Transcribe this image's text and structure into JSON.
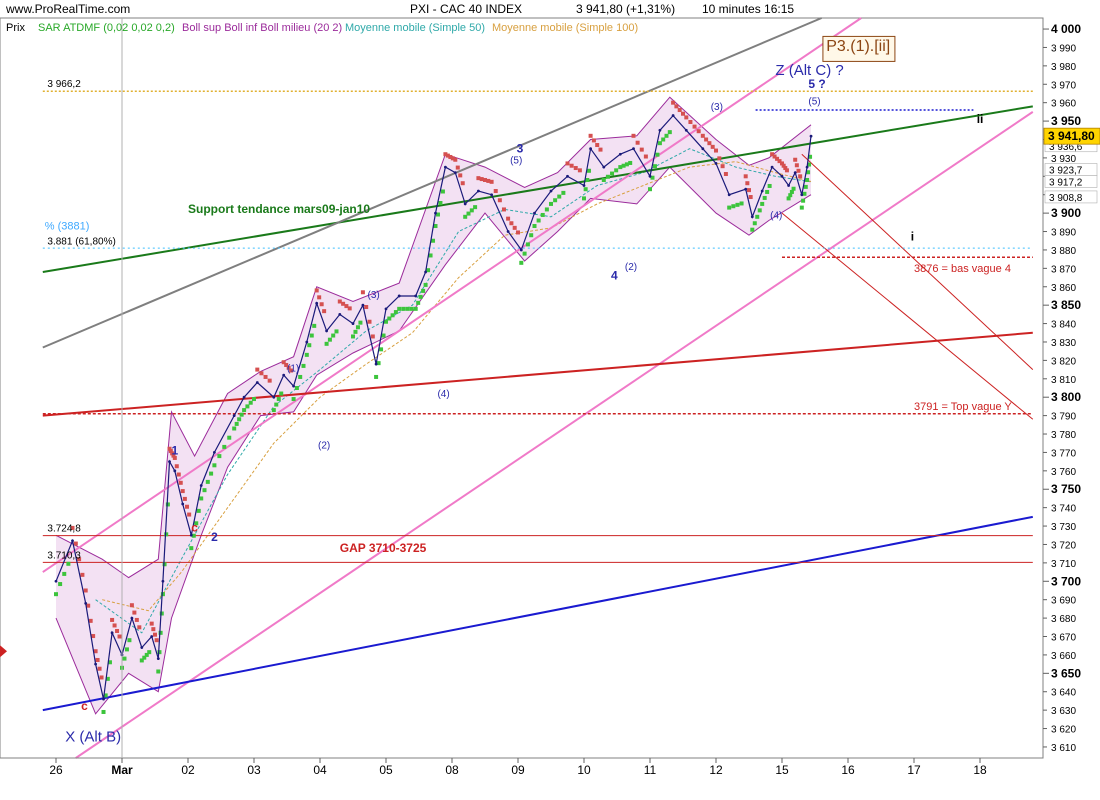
{
  "header": {
    "site": "www.ProRealTime.com",
    "instrument": "PXI - CAC 40 INDEX",
    "price_change": "3 941,80  (+1,31%)",
    "timeframe": "10 minutes  16:15"
  },
  "legend": {
    "prix": "Prix",
    "sar": "SAR ATDMF (0,02 0,02 0,2)",
    "boll": "Boll sup Boll inf Boll milieu (20 2)",
    "ma50": "Moyenne mobile (Simple 50)",
    "ma100": "Moyenne mobile (Simple 100)"
  },
  "colors": {
    "price": "#1a1a7a",
    "boll": "#9b2b9b",
    "boll_fill": "#f3e1f3",
    "sar_up": "#3cc43c",
    "sar_down": "#d55050",
    "ma50": "#2fa9a9",
    "ma100": "#d8a040",
    "channel": "#f07ac8",
    "support": "#1a7a1a",
    "gray_line": "#7f7f7f",
    "blue_line": "#1a1ad0",
    "red_line": "#cc2222",
    "fib": "#3fbfff",
    "orange_dotted": "#e0b030",
    "last_box": "#ffd400"
  },
  "chart_data": {
    "type": "line",
    "title": "PXI - CAC 40 INDEX",
    "timeframe": "10 minutes",
    "last_price": 3941.8,
    "change_pct": 1.31,
    "x_ticks": [
      "26",
      "Mar",
      "02",
      "03",
      "04",
      "05",
      "08",
      "09",
      "10",
      "11",
      "12",
      "15",
      "16",
      "17",
      "18"
    ],
    "ylim": [
      3604,
      4006
    ],
    "y_ticks": [
      3610,
      3620,
      3630,
      3640,
      3650,
      3660,
      3670,
      3680,
      3690,
      3700,
      3710,
      3720,
      3730,
      3740,
      3750,
      3760,
      3770,
      3780,
      3790,
      3800,
      3810,
      3820,
      3830,
      3840,
      3850,
      3860,
      3870,
      3880,
      3890,
      3900,
      3910,
      3920,
      3930,
      3940,
      3950,
      3960,
      3970,
      3980,
      3990,
      4000
    ],
    "y_tick_labels": [
      "3 610",
      "3 620",
      "3 630",
      "3 640",
      "3 650",
      "3 660",
      "3 670",
      "3 680",
      "3 690",
      "3 700",
      "3 710",
      "3 720",
      "3 730",
      "3 740",
      "3 750",
      "3 760",
      "3 770",
      "3 780",
      "3 790",
      "3 800",
      "3 810",
      "3 820",
      "3 830",
      "3 840",
      "3 850",
      "3 860",
      "3 870",
      "3 880",
      "3 890",
      "3 900",
      "3 910",
      "3 920",
      "3 930",
      "3 940",
      "3 950",
      "3 960",
      "3 970",
      "3 980",
      "3 990",
      "4 000"
    ],
    "y_major_labels": [
      "3 650",
      "3 700",
      "3 750",
      "3 800",
      "3 850",
      "3 900",
      "3 950",
      "4 000"
    ],
    "price_series": [
      {
        "x": 0.0,
        "y": 3700
      },
      {
        "x": 0.25,
        "y": 3722
      },
      {
        "x": 0.45,
        "y": 3688
      },
      {
        "x": 0.6,
        "y": 3655
      },
      {
        "x": 0.72,
        "y": 3636
      },
      {
        "x": 0.85,
        "y": 3672
      },
      {
        "x": 1.0,
        "y": 3660
      },
      {
        "x": 1.15,
        "y": 3680
      },
      {
        "x": 1.3,
        "y": 3664
      },
      {
        "x": 1.45,
        "y": 3670
      },
      {
        "x": 1.55,
        "y": 3658
      },
      {
        "x": 1.62,
        "y": 3700
      },
      {
        "x": 1.72,
        "y": 3765
      },
      {
        "x": 1.8,
        "y": 3760
      },
      {
        "x": 1.92,
        "y": 3742
      },
      {
        "x": 2.05,
        "y": 3725
      },
      {
        "x": 2.2,
        "y": 3752
      },
      {
        "x": 2.4,
        "y": 3770
      },
      {
        "x": 2.7,
        "y": 3790
      },
      {
        "x": 2.85,
        "y": 3800
      },
      {
        "x": 3.05,
        "y": 3808
      },
      {
        "x": 3.3,
        "y": 3800
      },
      {
        "x": 3.45,
        "y": 3812
      },
      {
        "x": 3.6,
        "y": 3806
      },
      {
        "x": 3.8,
        "y": 3830
      },
      {
        "x": 3.95,
        "y": 3851
      },
      {
        "x": 4.1,
        "y": 3836
      },
      {
        "x": 4.3,
        "y": 3845
      },
      {
        "x": 4.5,
        "y": 3840
      },
      {
        "x": 4.65,
        "y": 3850
      },
      {
        "x": 4.85,
        "y": 3818
      },
      {
        "x": 5.0,
        "y": 3848
      },
      {
        "x": 5.2,
        "y": 3855
      },
      {
        "x": 5.45,
        "y": 3855
      },
      {
        "x": 5.6,
        "y": 3868
      },
      {
        "x": 5.75,
        "y": 3900
      },
      {
        "x": 5.9,
        "y": 3925
      },
      {
        "x": 6.05,
        "y": 3922
      },
      {
        "x": 6.2,
        "y": 3905
      },
      {
        "x": 6.4,
        "y": 3912
      },
      {
        "x": 6.6,
        "y": 3910
      },
      {
        "x": 6.85,
        "y": 3890
      },
      {
        "x": 7.05,
        "y": 3880
      },
      {
        "x": 7.25,
        "y": 3900
      },
      {
        "x": 7.5,
        "y": 3912
      },
      {
        "x": 7.75,
        "y": 3920
      },
      {
        "x": 8.0,
        "y": 3915
      },
      {
        "x": 8.1,
        "y": 3935
      },
      {
        "x": 8.3,
        "y": 3925
      },
      {
        "x": 8.55,
        "y": 3932
      },
      {
        "x": 8.75,
        "y": 3935
      },
      {
        "x": 9.0,
        "y": 3920
      },
      {
        "x": 9.15,
        "y": 3945
      },
      {
        "x": 9.35,
        "y": 3953
      },
      {
        "x": 9.55,
        "y": 3945
      },
      {
        "x": 9.8,
        "y": 3935
      },
      {
        "x": 10.0,
        "y": 3927
      },
      {
        "x": 10.2,
        "y": 3910
      },
      {
        "x": 10.45,
        "y": 3913
      },
      {
        "x": 10.55,
        "y": 3898
      },
      {
        "x": 10.7,
        "y": 3912
      },
      {
        "x": 10.85,
        "y": 3925
      },
      {
        "x": 11.0,
        "y": 3920
      },
      {
        "x": 11.1,
        "y": 3915
      },
      {
        "x": 11.2,
        "y": 3922
      },
      {
        "x": 11.3,
        "y": 3910
      },
      {
        "x": 11.38,
        "y": 3925
      },
      {
        "x": 11.44,
        "y": 3941.8
      }
    ],
    "boll_upper": [
      {
        "x": 0.0,
        "y": 3725
      },
      {
        "x": 0.7,
        "y": 3712
      },
      {
        "x": 1.1,
        "y": 3702
      },
      {
        "x": 1.55,
        "y": 3712
      },
      {
        "x": 1.75,
        "y": 3792
      },
      {
        "x": 2.1,
        "y": 3768
      },
      {
        "x": 2.6,
        "y": 3802
      },
      {
        "x": 3.1,
        "y": 3814
      },
      {
        "x": 3.6,
        "y": 3822
      },
      {
        "x": 3.95,
        "y": 3860
      },
      {
        "x": 4.5,
        "y": 3852
      },
      {
        "x": 5.2,
        "y": 3862
      },
      {
        "x": 5.9,
        "y": 3932
      },
      {
        "x": 6.5,
        "y": 3925
      },
      {
        "x": 7.1,
        "y": 3914
      },
      {
        "x": 7.6,
        "y": 3922
      },
      {
        "x": 8.1,
        "y": 3940
      },
      {
        "x": 8.8,
        "y": 3942
      },
      {
        "x": 9.3,
        "y": 3963
      },
      {
        "x": 10.0,
        "y": 3940
      },
      {
        "x": 10.5,
        "y": 3926
      },
      {
        "x": 10.8,
        "y": 3930
      },
      {
        "x": 11.44,
        "y": 3948
      }
    ],
    "boll_lower": [
      {
        "x": 0.0,
        "y": 3680
      },
      {
        "x": 0.6,
        "y": 3628
      },
      {
        "x": 1.1,
        "y": 3650
      },
      {
        "x": 1.55,
        "y": 3640
      },
      {
        "x": 1.75,
        "y": 3680
      },
      {
        "x": 2.2,
        "y": 3725
      },
      {
        "x": 2.6,
        "y": 3762
      },
      {
        "x": 3.1,
        "y": 3790
      },
      {
        "x": 3.6,
        "y": 3792
      },
      {
        "x": 3.95,
        "y": 3812
      },
      {
        "x": 4.5,
        "y": 3824
      },
      {
        "x": 5.2,
        "y": 3836
      },
      {
        "x": 5.9,
        "y": 3872
      },
      {
        "x": 6.5,
        "y": 3900
      },
      {
        "x": 7.1,
        "y": 3874
      },
      {
        "x": 7.6,
        "y": 3890
      },
      {
        "x": 8.1,
        "y": 3908
      },
      {
        "x": 8.8,
        "y": 3905
      },
      {
        "x": 9.3,
        "y": 3925
      },
      {
        "x": 10.0,
        "y": 3900
      },
      {
        "x": 10.5,
        "y": 3888
      },
      {
        "x": 10.8,
        "y": 3896
      },
      {
        "x": 11.44,
        "y": 3910
      }
    ],
    "ma50": [
      {
        "x": 0.6,
        "y": 3690
      },
      {
        "x": 1.3,
        "y": 3672
      },
      {
        "x": 1.9,
        "y": 3712
      },
      {
        "x": 2.6,
        "y": 3758
      },
      {
        "x": 3.3,
        "y": 3795
      },
      {
        "x": 4.0,
        "y": 3815
      },
      {
        "x": 4.7,
        "y": 3836
      },
      {
        "x": 5.4,
        "y": 3850
      },
      {
        "x": 6.1,
        "y": 3890
      },
      {
        "x": 6.8,
        "y": 3902
      },
      {
        "x": 7.5,
        "y": 3898
      },
      {
        "x": 8.2,
        "y": 3915
      },
      {
        "x": 8.9,
        "y": 3922
      },
      {
        "x": 9.6,
        "y": 3935
      },
      {
        "x": 10.3,
        "y": 3925
      },
      {
        "x": 10.9,
        "y": 3920
      },
      {
        "x": 11.44,
        "y": 3917
      }
    ],
    "ma100": [
      {
        "x": 0.7,
        "y": 3690
      },
      {
        "x": 1.4,
        "y": 3684
      },
      {
        "x": 1.9,
        "y": 3705
      },
      {
        "x": 2.6,
        "y": 3740
      },
      {
        "x": 3.3,
        "y": 3775
      },
      {
        "x": 4.0,
        "y": 3800
      },
      {
        "x": 4.7,
        "y": 3818
      },
      {
        "x": 5.4,
        "y": 3835
      },
      {
        "x": 6.1,
        "y": 3865
      },
      {
        "x": 6.8,
        "y": 3888
      },
      {
        "x": 7.5,
        "y": 3892
      },
      {
        "x": 8.2,
        "y": 3905
      },
      {
        "x": 8.9,
        "y": 3915
      },
      {
        "x": 9.6,
        "y": 3925
      },
      {
        "x": 10.3,
        "y": 3928
      },
      {
        "x": 10.9,
        "y": 3922
      },
      {
        "x": 11.44,
        "y": 3917.2
      }
    ],
    "trend_lines": [
      {
        "name": "support",
        "x1": -0.2,
        "y1": 3868,
        "x2": 14.8,
        "y2": 3958,
        "color": "support",
        "width": 2,
        "dash": ""
      },
      {
        "name": "gray",
        "x1": -0.2,
        "y1": 3827,
        "x2": 11.6,
        "y2": 4006,
        "color": "gray_line",
        "width": 2,
        "dash": ""
      },
      {
        "name": "channel-upper",
        "x1": -0.2,
        "y1": 3705,
        "x2": 12.2,
        "y2": 4006,
        "color": "channel",
        "width": 2,
        "dash": ""
      },
      {
        "name": "channel-lower",
        "x1": 0.3,
        "y1": 3604,
        "x2": 14.8,
        "y2": 3955,
        "color": "channel",
        "width": 2,
        "dash": ""
      },
      {
        "name": "blue",
        "x1": -0.2,
        "y1": 3630,
        "x2": 14.8,
        "y2": 3735,
        "color": "blue_line",
        "width": 2,
        "dash": ""
      },
      {
        "name": "red",
        "x1": -0.2,
        "y1": 3790,
        "x2": 14.8,
        "y2": 3835,
        "color": "red_line",
        "width": 2,
        "dash": ""
      },
      {
        "name": "thin-red-1",
        "x1": 11.0,
        "y1": 3900,
        "x2": 14.8,
        "y2": 3788,
        "color": "red_line",
        "width": 1,
        "dash": ""
      },
      {
        "name": "thin-red-2",
        "x1": 11.3,
        "y1": 3932,
        "x2": 14.8,
        "y2": 3815,
        "color": "red_line",
        "width": 1,
        "dash": ""
      }
    ],
    "h_levels": [
      {
        "name": "level-3966",
        "y": 3966.2,
        "x1": -0.2,
        "x2": 14.8,
        "color": "orange_dotted",
        "dash": "2,2",
        "width": 1.5
      },
      {
        "name": "level-fib",
        "y": 3881,
        "x1": -0.2,
        "x2": 14.8,
        "color": "fib",
        "dash": "2,3",
        "width": 1
      },
      {
        "name": "level-3876",
        "y": 3876,
        "x1": 11.0,
        "x2": 14.8,
        "color": "red_line",
        "dash": "3,2",
        "width": 1.5
      },
      {
        "name": "level-3791",
        "y": 3791,
        "x1": -0.2,
        "x2": 14.8,
        "color": "red_line",
        "dash": "3,2",
        "width": 1.5
      },
      {
        "name": "level-3724",
        "y": 3724.8,
        "x1": -0.2,
        "x2": 14.8,
        "color": "red_line",
        "dash": "",
        "width": 1
      },
      {
        "name": "level-3710",
        "y": 3710.3,
        "x1": -0.2,
        "x2": 14.8,
        "color": "red_line",
        "dash": "",
        "width": 1
      },
      {
        "name": "level-3956",
        "y": 3956,
        "x1": 10.6,
        "x2": 13.9,
        "color": "blue_line",
        "dash": "2,2",
        "width": 1.5
      }
    ],
    "last_price_label": "3 941,80",
    "right_values": [
      {
        "y": 3936.6,
        "label": "3 936,6"
      },
      {
        "y": 3923.7,
        "label": "3 923,7"
      },
      {
        "y": 3917.2,
        "label": "3 917,2"
      },
      {
        "y": 3908.8,
        "label": "3 908,8"
      }
    ],
    "annotations": [
      {
        "text": "3 966,2",
        "x": -0.13,
        "y": 3968.5,
        "color": "#000000",
        "size": 10,
        "weight": "normal"
      },
      {
        "text": "3.881 (61,80%)",
        "x": -0.13,
        "y": 3883,
        "color": "#000000",
        "size": 10,
        "weight": "normal"
      },
      {
        "text": "% (3881)",
        "x": -0.17,
        "y": 3891,
        "color": "#3fa9ff",
        "size": 11,
        "weight": "normal"
      },
      {
        "text": "3.724,8",
        "x": -0.13,
        "y": 3727,
        "color": "#000000",
        "size": 10,
        "weight": "normal"
      },
      {
        "text": "3.710,3",
        "x": -0.13,
        "y": 3712.5,
        "color": "#000000",
        "size": 10,
        "weight": "normal"
      },
      {
        "text": "Support tendance mars09-jan10",
        "x": 2.0,
        "y": 3900,
        "color": "#1a7a1a",
        "size": 12,
        "weight": "bold"
      },
      {
        "text": "GAP 3710-3725",
        "x": 4.3,
        "y": 3716,
        "color": "#cc2222",
        "size": 12,
        "weight": "bold"
      },
      {
        "text": "3876 = bas vague 4",
        "x": 13.0,
        "y": 3868,
        "color": "#cc2222",
        "size": 11,
        "weight": "normal"
      },
      {
        "text": "3791 = Top vague Y",
        "x": 13.0,
        "y": 3793,
        "color": "#cc2222",
        "size": 11,
        "weight": "normal"
      },
      {
        "text": "Z (Alt C) ?",
        "x": 10.9,
        "y": 3975,
        "color": "#2a2aaa",
        "size": 15,
        "weight": "normal"
      },
      {
        "text": "5 ?",
        "x": 11.4,
        "y": 3968,
        "color": "#2a2aaa",
        "size": 12,
        "weight": "bold"
      },
      {
        "text": "(5)",
        "x": 11.4,
        "y": 3959,
        "color": "#2a2aaa",
        "size": 10,
        "weight": "normal"
      },
      {
        "text": "X (Alt B)",
        "x": 0.14,
        "y": 3613,
        "color": "#2a2aaa",
        "size": 15,
        "weight": "normal"
      },
      {
        "text": "c",
        "x": 0.38,
        "y": 3630,
        "color": "#cc2222",
        "size": 12,
        "weight": "bold"
      },
      {
        "text": "1",
        "x": 1.75,
        "y": 3769,
        "color": "#2a2aaa",
        "size": 12,
        "weight": "bold"
      },
      {
        "text": "c",
        "x": 2.05,
        "y": 3727,
        "color": "#cc2222",
        "size": 12,
        "weight": "bold"
      },
      {
        "text": "2",
        "x": 2.35,
        "y": 3722,
        "color": "#2a2aaa",
        "size": 12,
        "weight": "bold"
      },
      {
        "text": "(1)",
        "x": 3.5,
        "y": 3814,
        "color": "#2a2aaa",
        "size": 10,
        "weight": "normal"
      },
      {
        "text": "(2)",
        "x": 3.97,
        "y": 3772,
        "color": "#2a2aaa",
        "size": 10,
        "weight": "normal"
      },
      {
        "text": "(3)",
        "x": 4.72,
        "y": 3854,
        "color": "#2a2aaa",
        "size": 10,
        "weight": "normal"
      },
      {
        "text": "(4)",
        "x": 5.78,
        "y": 3800,
        "color": "#2a2aaa",
        "size": 10,
        "weight": "normal"
      },
      {
        "text": "3",
        "x": 6.98,
        "y": 3933,
        "color": "#2a2aaa",
        "size": 12,
        "weight": "bold"
      },
      {
        "text": "(5)",
        "x": 6.88,
        "y": 3927,
        "color": "#2a2aaa",
        "size": 10,
        "weight": "normal"
      },
      {
        "text": "4",
        "x": 8.41,
        "y": 3864,
        "color": "#2a2aaa",
        "size": 12,
        "weight": "bold"
      },
      {
        "text": "(2)",
        "x": 8.62,
        "y": 3869,
        "color": "#2a2aaa",
        "size": 10,
        "weight": "normal"
      },
      {
        "text": "(3)",
        "x": 9.92,
        "y": 3956,
        "color": "#2a2aaa",
        "size": 10,
        "weight": "normal"
      },
      {
        "text": "(4)",
        "x": 10.82,
        "y": 3897,
        "color": "#2a2aaa",
        "size": 10,
        "weight": "normal"
      },
      {
        "text": "i",
        "x": 12.95,
        "y": 3885,
        "color": "#000000",
        "size": 12,
        "weight": "bold"
      },
      {
        "text": "ii",
        "x": 13.95,
        "y": 3949,
        "color": "#000000",
        "size": 12,
        "weight": "bold"
      },
      {
        "text": "P3.(1).[ii]",
        "x": 11.67,
        "y": 3988,
        "color": "#8b4513",
        "size": 16,
        "weight": "normal"
      }
    ],
    "grid": false,
    "legend_position": "top-left"
  }
}
